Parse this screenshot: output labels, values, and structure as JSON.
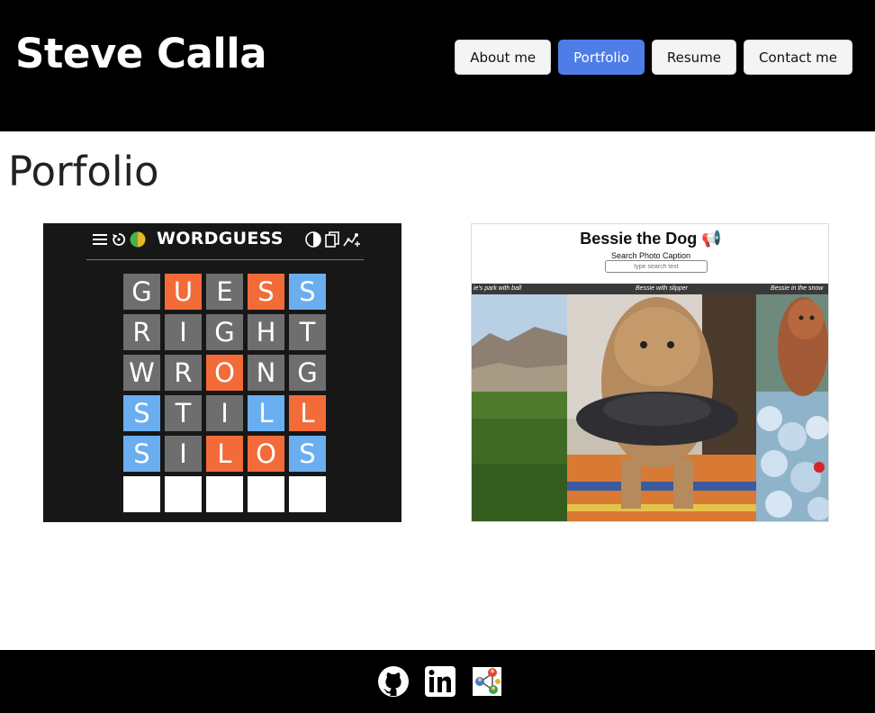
{
  "header": {
    "title": "Steve Calla",
    "nav": [
      "About me",
      "Portfolio",
      "Resume",
      "Contact me"
    ],
    "active": "Portfolio"
  },
  "main": {
    "title": "Porfolio"
  },
  "projects": {
    "wordguess": {
      "title": "WORDGUESS",
      "rows": [
        [
          [
            "G",
            "g"
          ],
          [
            "U",
            "o"
          ],
          [
            "E",
            "g"
          ],
          [
            "S",
            "o"
          ],
          [
            "S",
            "b"
          ]
        ],
        [
          [
            "R",
            "g"
          ],
          [
            "I",
            "g"
          ],
          [
            "G",
            "g"
          ],
          [
            "H",
            "g"
          ],
          [
            "T",
            "g"
          ]
        ],
        [
          [
            "W",
            "g"
          ],
          [
            "R",
            "g"
          ],
          [
            "O",
            "o"
          ],
          [
            "N",
            "g"
          ],
          [
            "G",
            "g"
          ]
        ],
        [
          [
            "S",
            "b"
          ],
          [
            "T",
            "g"
          ],
          [
            "I",
            "g"
          ],
          [
            "L",
            "b"
          ],
          [
            "L",
            "o"
          ]
        ],
        [
          [
            "S",
            "b"
          ],
          [
            "I",
            "g"
          ],
          [
            "L",
            "o"
          ],
          [
            "O",
            "o"
          ],
          [
            "S",
            "b"
          ]
        ],
        [
          [
            "",
            "w"
          ],
          [
            "",
            "w"
          ],
          [
            "",
            "w"
          ],
          [
            "",
            "w"
          ],
          [
            "",
            "w"
          ]
        ]
      ]
    },
    "bessie": {
      "title": "Bessie the Dog 📢",
      "search_label": "Search Photo Caption",
      "search_placeholder": "type search text",
      "captions": [
        "ie's park with ball",
        "Bessie with slipper",
        "Bessie in the snow"
      ]
    }
  },
  "footer": {
    "icons": [
      "github-icon",
      "linkedin-icon",
      "network-app-icon"
    ]
  },
  "colors": {
    "header_bg": "#000000",
    "nav_active": "#4f7de8",
    "tile_gray": "#6e6e6e",
    "tile_orange": "#f26b38",
    "tile_blue": "#6aaef0"
  }
}
